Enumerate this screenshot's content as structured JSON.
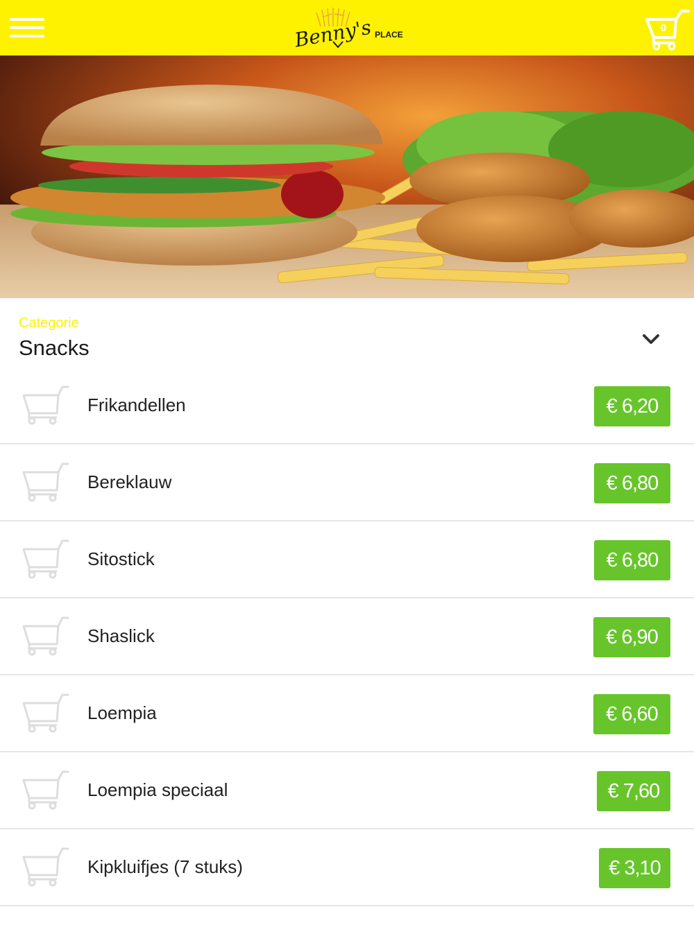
{
  "header": {
    "brand": "Benny's",
    "brand_sub": "PLACE",
    "cart_count": "0"
  },
  "colors": {
    "header_bg": "#fff200",
    "price_badge": "#67c52b",
    "category_label": "#fff200"
  },
  "icons": {
    "menu": "hamburger-menu-icon",
    "cart": "shopping-cart-icon",
    "dropdown": "chevron-down-icon"
  },
  "hero": {
    "description_icon": "food-banner-image"
  },
  "category": {
    "label": "Categorie",
    "value": "Snacks"
  },
  "items": [
    {
      "name": "Frikandellen",
      "price": "€ 6,20"
    },
    {
      "name": "Bereklauw",
      "price": "€ 6,80"
    },
    {
      "name": "Sitostick",
      "price": "€ 6,80"
    },
    {
      "name": "Shaslick",
      "price": "€ 6,90"
    },
    {
      "name": "Loempia",
      "price": "€ 6,60"
    },
    {
      "name": "Loempia speciaal",
      "price": "€ 7,60"
    },
    {
      "name": "Kipkluifjes (7 stuks)",
      "price": "€ 3,10"
    }
  ]
}
